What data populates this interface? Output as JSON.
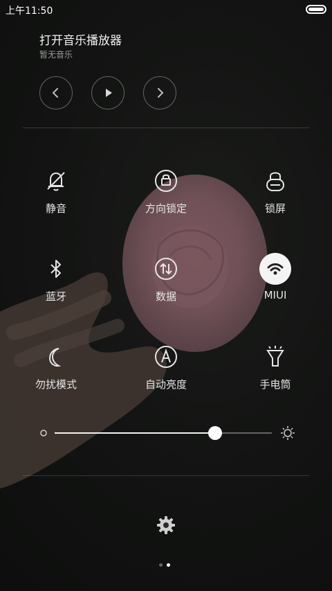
{
  "status_bar": {
    "time": "上午11:50",
    "battery_icon": "battery-full-icon"
  },
  "music": {
    "title": "打开音乐播放器",
    "subtitle": "暂无音乐",
    "controls": [
      {
        "name": "previous",
        "icon": "chevron-left-icon"
      },
      {
        "name": "play",
        "icon": "play-icon"
      },
      {
        "name": "next",
        "icon": "chevron-right-icon"
      }
    ]
  },
  "toggles": [
    {
      "id": "mute",
      "label": "静音",
      "icon": "bell-off-icon",
      "active": false
    },
    {
      "id": "rotation-lock",
      "label": "方向锁定",
      "icon": "rotation-lock-icon",
      "active": false
    },
    {
      "id": "lock-screen",
      "label": "锁屏",
      "icon": "lock-icon",
      "active": false
    },
    {
      "id": "bluetooth",
      "label": "蓝牙",
      "icon": "bluetooth-icon",
      "active": false
    },
    {
      "id": "data",
      "label": "数据",
      "icon": "data-icon",
      "active": false
    },
    {
      "id": "wifi",
      "label": "MIUI",
      "icon": "wifi-icon",
      "active": true
    },
    {
      "id": "dnd",
      "label": "勿扰模式",
      "icon": "moon-icon",
      "active": false
    },
    {
      "id": "auto-brightness",
      "label": "自动亮度",
      "icon": "auto-brightness-icon",
      "active": false
    },
    {
      "id": "flashlight",
      "label": "手电筒",
      "icon": "flashlight-icon",
      "active": false
    }
  ],
  "brightness": {
    "level": 0.74,
    "min_icon": "brightness-low-icon",
    "max_icon": "brightness-high-icon"
  },
  "settings_icon": "gear-icon",
  "pager": {
    "total": 2,
    "current": 2
  },
  "colors": {
    "active_toggle_bg": "#f4f4f4",
    "text": "#e6e6e6",
    "subtext": "#9a9a9a"
  }
}
